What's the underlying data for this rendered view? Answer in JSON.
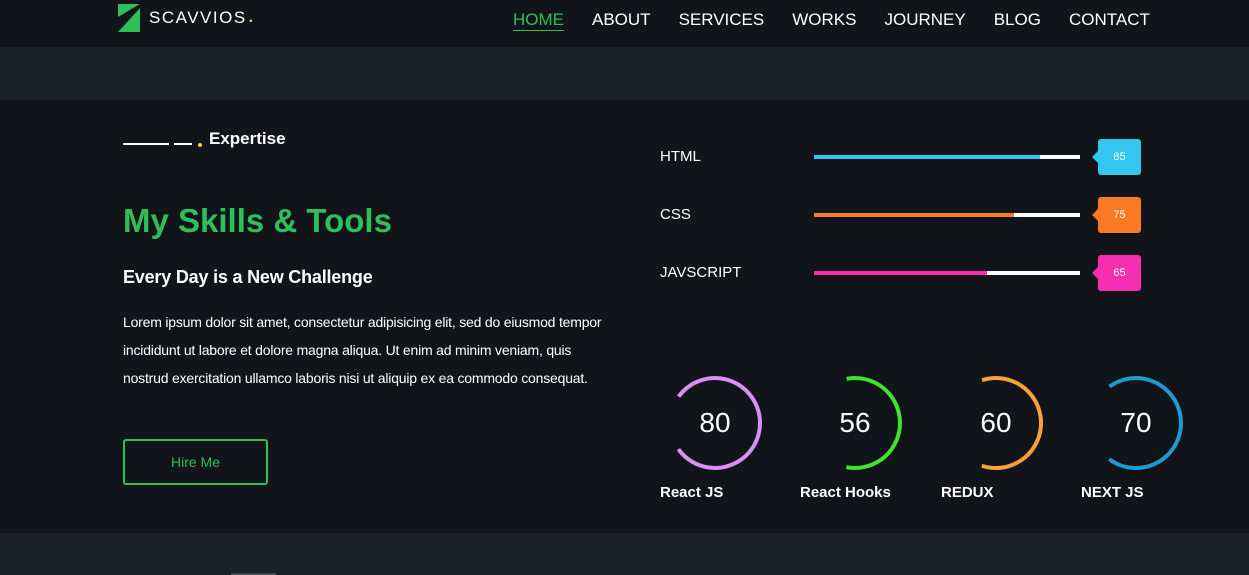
{
  "brand": {
    "name": "SCAVVIOS",
    "dot": ".",
    "logo_color": "#2fbf5a",
    "dot_color": "#f2d13a"
  },
  "nav": {
    "items": [
      {
        "label": "HOME",
        "active": true
      },
      {
        "label": "ABOUT",
        "active": false
      },
      {
        "label": "SERVICES",
        "active": false
      },
      {
        "label": "WORKS",
        "active": false
      },
      {
        "label": "JOURNEY",
        "active": false
      },
      {
        "label": "BLOG",
        "active": false
      },
      {
        "label": "CONTACT",
        "active": false
      }
    ]
  },
  "section": {
    "eyebrow": "Expertise",
    "title": "My Skills & Tools",
    "subtitle": "Every Day is a New Challenge",
    "body": "Lorem ipsum dolor sit amet, consectetur adipisicing elit, sed do eiusmod tempor incididunt ut labore et dolore magna aliqua. Ut enim ad minim veniam, quis nostrud exercitation ullamco laboris nisi ut aliquip ex ea commodo consequat.",
    "button": "Hire Me"
  },
  "skills": [
    {
      "name": "HTML",
      "value": "85",
      "color": "#35c6ef"
    },
    {
      "name": "CSS",
      "value": "75",
      "color": "#fb7a23"
    },
    {
      "name": "JAVSCRIPT",
      "value": "65",
      "color": "#f62eb0"
    }
  ],
  "tools": [
    {
      "name": "React JS",
      "value": "80",
      "color": "#da8ff5"
    },
    {
      "name": "React Hooks",
      "value": "56",
      "color": "#3fe42f"
    },
    {
      "name": "REDUX",
      "value": "60",
      "color": "#f9a13a"
    },
    {
      "name": "NEXT JS",
      "value": "70",
      "color": "#1e9ad1"
    }
  ],
  "colors": {
    "accent": "#2fbf5a",
    "background": "#111419",
    "band": "#1a1f28"
  }
}
